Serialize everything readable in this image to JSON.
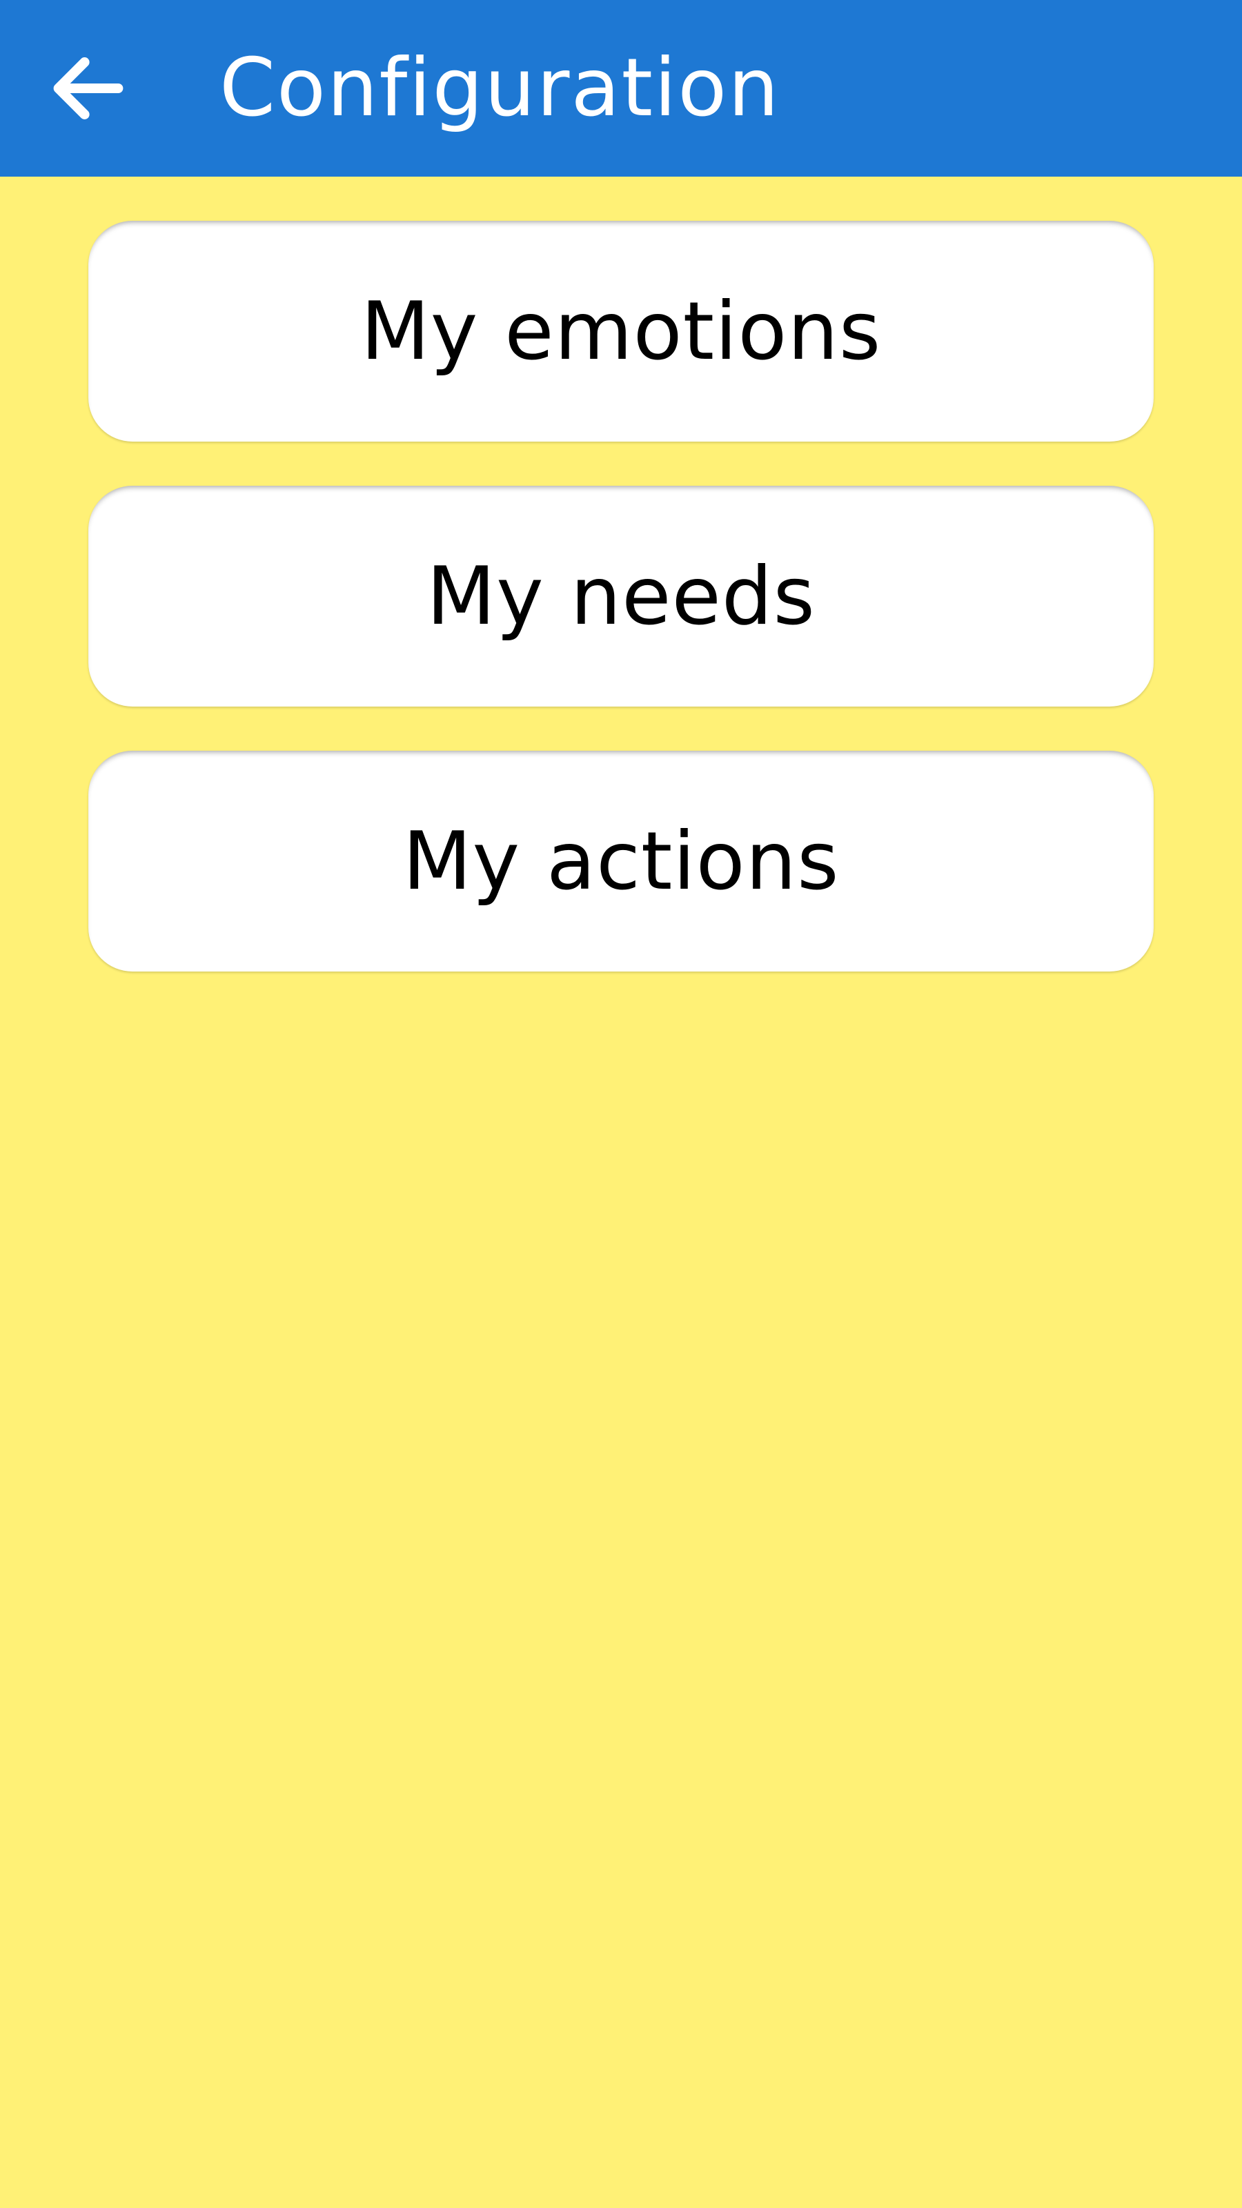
{
  "appbar": {
    "title": "Configuration",
    "back_icon": "arrow-left-icon",
    "background_color": "#1E78D3"
  },
  "page": {
    "background_color": "#FFF176"
  },
  "menu": {
    "items": [
      {
        "label": "My emotions"
      },
      {
        "label": "My needs"
      },
      {
        "label": "My actions"
      }
    ]
  }
}
